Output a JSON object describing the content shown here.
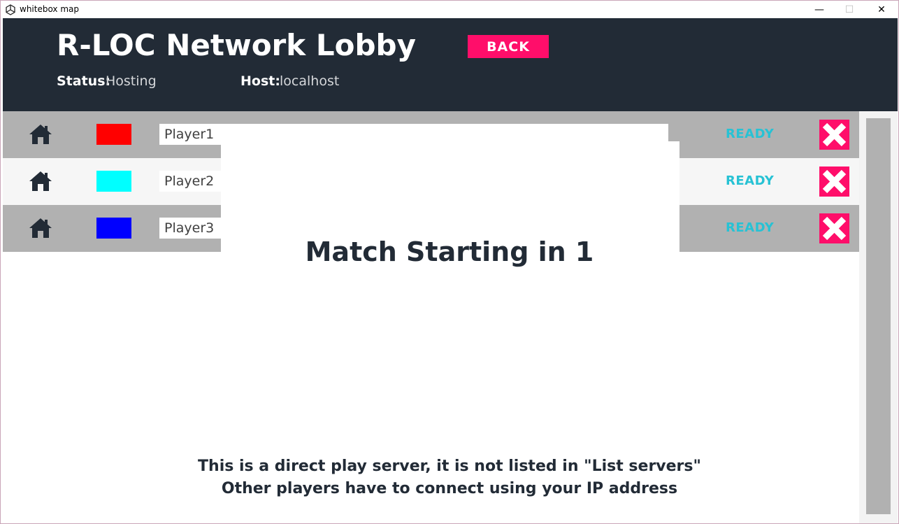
{
  "window": {
    "title": "whitebox map",
    "minimize_glyph": "—",
    "maximize_glyph": "☐",
    "close_glyph": "✕",
    "icon": "unity-icon"
  },
  "header": {
    "title": "R-LOC Network Lobby",
    "back_label": "BACK",
    "status_label": "Status:",
    "status_value": "Hosting",
    "host_label": "Host:",
    "host_value": "localhost"
  },
  "players": [
    {
      "name": "Player1",
      "color": "#ff0000",
      "status": "READY",
      "icon": "home-icon"
    },
    {
      "name": "Player2",
      "color": "#00ffff",
      "status": "READY",
      "icon": "home-icon"
    },
    {
      "name": "Player3",
      "color": "#0000ff",
      "status": "READY",
      "icon": "home-icon"
    }
  ],
  "countdown": "Match Starting in 1",
  "footer": {
    "line1": "This is a direct play server, it is not listed in \"List servers\"",
    "line2": "Other players have to connect using your IP address"
  },
  "colors": {
    "header_bg": "#222b36",
    "accent": "#ff0e6a",
    "ready": "#27c2d4",
    "row_gray": "#b1b1b1"
  }
}
